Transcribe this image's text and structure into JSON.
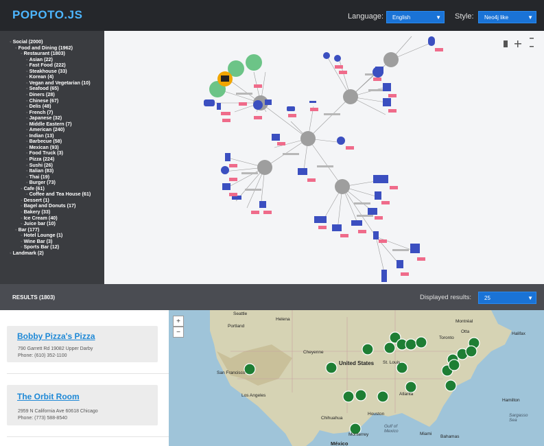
{
  "header": {
    "logo": "POPOTO.JS",
    "language_label": "Language:",
    "language_value": "English",
    "style_label": "Style:",
    "style_value": "Neo4j like"
  },
  "tree": [
    {
      "label": "Social (2000)",
      "level": 0
    },
    {
      "label": "Food and Dining (1962)",
      "level": 1
    },
    {
      "label": "Restaurant (1803)",
      "level": 2
    },
    {
      "label": "Asian (22)",
      "level": 3
    },
    {
      "label": "Fast Food (222)",
      "level": 3
    },
    {
      "label": "Steakhouse (33)",
      "level": 3
    },
    {
      "label": "Korean (4)",
      "level": 3
    },
    {
      "label": "Vegan and Vegetarian (10)",
      "level": 3
    },
    {
      "label": "Seafood (65)",
      "level": 3
    },
    {
      "label": "Diners (28)",
      "level": 3
    },
    {
      "label": "Chinese (67)",
      "level": 3
    },
    {
      "label": "Delis (48)",
      "level": 3
    },
    {
      "label": "French (7)",
      "level": 3
    },
    {
      "label": "Japanese (32)",
      "level": 3
    },
    {
      "label": "Middle Eastern (7)",
      "level": 3
    },
    {
      "label": "American (240)",
      "level": 3
    },
    {
      "label": "Indian (13)",
      "level": 3
    },
    {
      "label": "Barbecue (58)",
      "level": 3
    },
    {
      "label": "Mexican (93)",
      "level": 3
    },
    {
      "label": "Food Truck (3)",
      "level": 3
    },
    {
      "label": "Pizza (224)",
      "level": 3
    },
    {
      "label": "Sushi (26)",
      "level": 3
    },
    {
      "label": "Italian (83)",
      "level": 3
    },
    {
      "label": "Thai (19)",
      "level": 3
    },
    {
      "label": "Burger (73)",
      "level": 3
    },
    {
      "label": "Cafe (61)",
      "level": 2
    },
    {
      "label": "Coffee and Tea House (61)",
      "level": 3
    },
    {
      "label": "Dessert (1)",
      "level": 2
    },
    {
      "label": "Bagel and Donuts (17)",
      "level": 2
    },
    {
      "label": "Bakery (33)",
      "level": 2
    },
    {
      "label": "Ice Cream (40)",
      "level": 2
    },
    {
      "label": "Juice bar (10)",
      "level": 2
    },
    {
      "label": "Bar (177)",
      "level": 1
    },
    {
      "label": "Hotel Lounge (1)",
      "level": 2
    },
    {
      "label": "Wine Bar (3)",
      "level": 2
    },
    {
      "label": "Sports Bar (12)",
      "level": 2
    },
    {
      "label": "Landmark (2)",
      "level": 0
    }
  ],
  "results": {
    "title": "RESULTS (1803)",
    "displayed_label": "Displayed results:",
    "displayed_value": "25",
    "items": [
      {
        "name": "Bobby Pizza's Pizza",
        "address": "790 Garrett Rd 19082 Upper Darby",
        "phone": "Phone: (610) 352-1100"
      },
      {
        "name": "The Orbit Room",
        "address": "2959 N California Ave 60618 Chicago",
        "phone": "Phone: (773) 588-8540"
      }
    ]
  },
  "map": {
    "zoom_in": "+",
    "zoom_out": "−",
    "labels": [
      "Seattle",
      "Portland",
      "Helena",
      "Montréal",
      "Toronto",
      "Halifax",
      "Cheyenne",
      "United States",
      "St. Louis",
      "San Francisco",
      "Los Angeles",
      "Atlanta",
      "Houston",
      "Chihuahua",
      "Monterrey",
      "México",
      "Miami",
      "Bahamas",
      "Hamilton",
      "Sargasso Sea",
      "Gulf of Mexico",
      "Otta"
    ]
  },
  "graph": {
    "colors": {
      "node": "#9e9e9e",
      "icon": "#3b4fc0",
      "badge": "#ef6b8a",
      "green": "#6cc487",
      "orange": "#f0a500"
    }
  }
}
